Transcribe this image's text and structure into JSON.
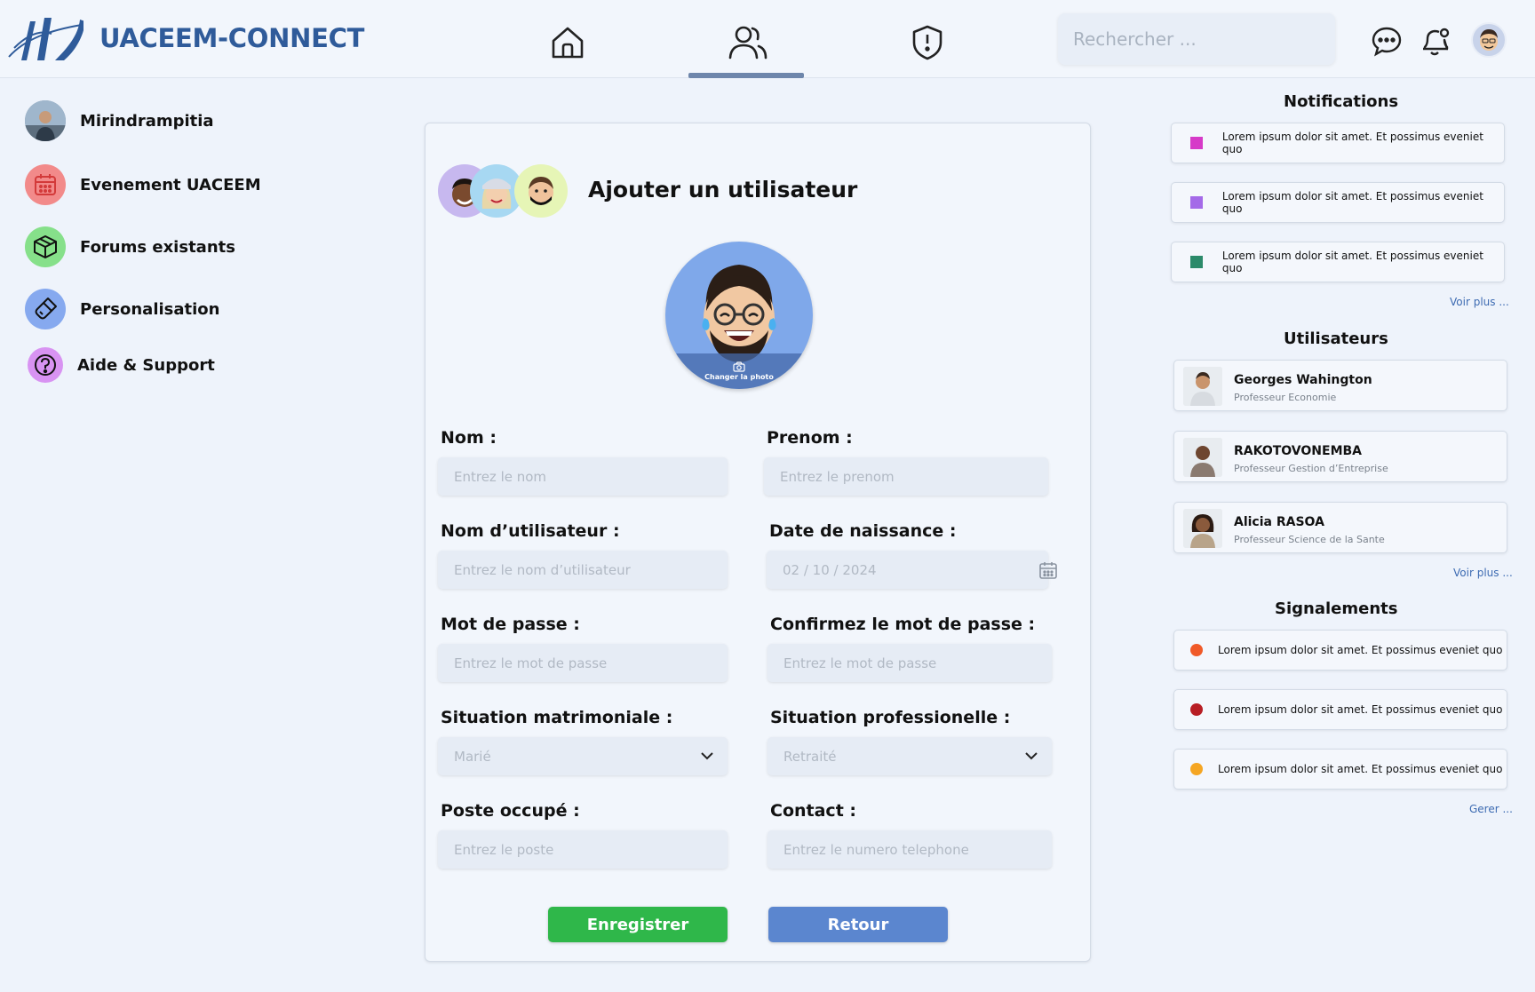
{
  "header": {
    "app_title": "UACEEM-CONNECT",
    "search_placeholder": "Rechercher ..."
  },
  "sidebar": {
    "items": [
      {
        "label": "Mirindrampitia",
        "icon": "profile-avatar"
      },
      {
        "label": "Evenement UACEEM",
        "icon": "calendar-icon",
        "color": "#f07a7a"
      },
      {
        "label": "Forums existants",
        "icon": "box-icon",
        "color": "#7fe07f"
      },
      {
        "label": "Personalisation",
        "icon": "brush-icon",
        "color": "#7ea6f0"
      },
      {
        "label": "Aide & Support",
        "icon": "help-icon",
        "color": "#d08af0"
      }
    ]
  },
  "form": {
    "title": "Ajouter un utilisateur",
    "change_photo": "Changer la photo",
    "fields": {
      "nom": {
        "label": "Nom :",
        "placeholder": "Entrez le nom"
      },
      "prenom": {
        "label": "Prenom :",
        "placeholder": "Entrez le prenom"
      },
      "username": {
        "label": "Nom d’utilisateur :",
        "placeholder": "Entrez le nom d’utilisateur"
      },
      "birthdate": {
        "label": "Date de naissance :",
        "placeholder": "02 / 10 / 2024"
      },
      "password": {
        "label": "Mot de passe :",
        "placeholder": "Entrez le mot de passe"
      },
      "confirm": {
        "label": "Confirmez le mot de passe :",
        "placeholder": "Entrez le mot de passe"
      },
      "marital": {
        "label": "Situation matrimoniale :",
        "value": "Marié"
      },
      "professional": {
        "label": "Situation professionelle :",
        "value": "Retraité"
      },
      "position": {
        "label": "Poste occupé :",
        "placeholder": "Entrez le poste"
      },
      "contact": {
        "label": "Contact :",
        "placeholder": "Entrez le numero telephone"
      }
    },
    "save_label": "Enregistrer",
    "back_label": "Retour",
    "save_color": "#2fb74a",
    "back_color": "#5b86cf"
  },
  "notifications": {
    "title": "Notifications",
    "items": [
      {
        "text": "Lorem ipsum dolor sit amet. Et possimus eveniet quo",
        "color": "#d63ac8"
      },
      {
        "text": "Lorem ipsum dolor sit amet. Et possimus eveniet quo",
        "color": "#a46ae8"
      },
      {
        "text": "Lorem ipsum dolor sit amet. Et possimus eveniet quo",
        "color": "#2b8a6a"
      }
    ],
    "more": "Voir plus ..."
  },
  "users": {
    "title": "Utilisateurs",
    "items": [
      {
        "name": "Georges Wahington",
        "role": "Professeur Economie"
      },
      {
        "name": "RAKOTOVONEMBA",
        "role": "Professeur Gestion d’Entreprise"
      },
      {
        "name": "Alicia RASOA",
        "role": "Professeur Science de la Sante"
      }
    ],
    "more": "Voir plus ..."
  },
  "reports": {
    "title": "Signalements",
    "items": [
      {
        "text": "Lorem ipsum dolor sit amet. Et possimus eveniet quo",
        "color": "#f05a28"
      },
      {
        "text": "Lorem ipsum dolor sit amet. Et possimus eveniet quo",
        "color": "#b81e24"
      },
      {
        "text": "Lorem ipsum dolor sit amet. Et possimus eveniet quo",
        "color": "#f5a623"
      }
    ],
    "more": "Gerer ..."
  }
}
